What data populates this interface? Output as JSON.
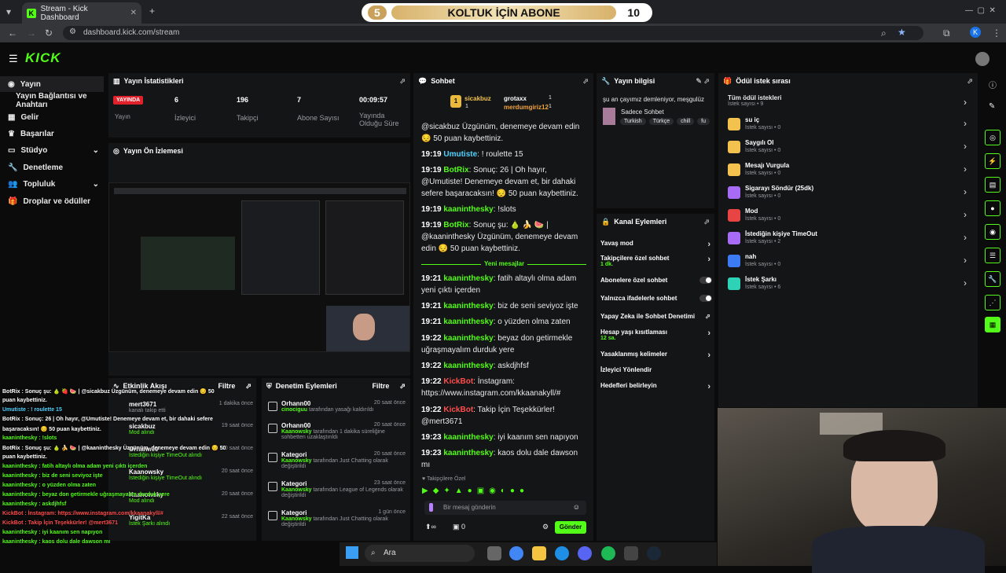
{
  "browser": {
    "tab_title": "Stream - Kick Dashboard",
    "url": "dashboard.kick.com/stream",
    "new_tab": "+",
    "profile_initial": "K"
  },
  "goal_banner": {
    "left": "5",
    "title": "KOLTUK İÇİN ABONE",
    "right": "10"
  },
  "kick": {
    "logo": "KICK"
  },
  "sidebar": {
    "items": [
      {
        "label": "Yayın",
        "icon": "broadcast-icon"
      },
      {
        "label": "Yayın Bağlantısı ve Anahtarı",
        "icon": ""
      },
      {
        "label": "Gelir",
        "icon": "revenue-icon"
      },
      {
        "label": "Başarılar",
        "icon": "trophy-icon"
      },
      {
        "label": "Stüdyo",
        "icon": "studio-icon"
      },
      {
        "label": "Denetleme",
        "icon": "wrench-icon"
      },
      {
        "label": "Topluluk",
        "icon": "people-icon"
      },
      {
        "label": "Droplar ve ödüller",
        "icon": "gift-icon"
      }
    ]
  },
  "stats": {
    "title": "Yayın İstatistikleri",
    "live_badge": "YAYINDA",
    "live_label": "Yayın",
    "items": [
      {
        "value": "6",
        "label": "İzleyici"
      },
      {
        "value": "196",
        "label": "Takipçi"
      },
      {
        "value": "7",
        "label": "Abone Sayısı"
      },
      {
        "value": "00:09:57",
        "label": "Yayında Olduğu Süre"
      }
    ]
  },
  "preview": {
    "title": "Yayın Ön İzlemesi"
  },
  "activity": {
    "title": "Etkinlik Akışı",
    "filter": "Filtre",
    "rows": [
      {
        "name": "mert3671",
        "sub": "kanalı takip etti",
        "date": "1 dakika önce"
      },
      {
        "name": "sicakbuz",
        "sub": "Mod alındı",
        "date": "19 saat önce"
      },
      {
        "name": "Orhann00",
        "sub": "İstediğin kişiye TimeOut alındı",
        "date": "20 saat önce"
      },
      {
        "name": "Kaanowsky",
        "sub": "İstediğin kişiye TimeOut alındı",
        "date": "20 saat önce"
      },
      {
        "name": "Kaanowsky",
        "sub": "Mod alındı",
        "date": "20 saat önce"
      },
      {
        "name": "YigitKa",
        "sub": "İstek Şarkı alındı",
        "date": "22 saat önce"
      }
    ]
  },
  "moderation": {
    "title": "Denetim Eylemleri",
    "filter": "Filtre",
    "rows": [
      {
        "name": "Orhann00",
        "actor": "cinociguu",
        "text": "tarafından yasağı kaldırıldı",
        "date": "20 saat önce"
      },
      {
        "name": "Orhann00",
        "actor": "Kaanowsky",
        "text": "tarafından 1 dakika süreliğine sohbetten uzaklaştırıldı",
        "date": "20 saat önce"
      },
      {
        "name": "Kategori",
        "actor": "Kaanowsky",
        "text": "tarafından Just Chatting olarak değiştirildi",
        "date": "20 saat önce"
      },
      {
        "name": "Kategori",
        "actor": "Kaanowsky",
        "text": "tarafından League of Legends olarak değiştirildi",
        "date": "23 saat önce"
      },
      {
        "name": "Kategori",
        "actor": "Kaanowsky",
        "text": "tarafından Just Chatting olarak değiştirildi",
        "date": "1 gün önce"
      }
    ]
  },
  "chat": {
    "title": "Sohbet",
    "leaders": [
      {
        "name": "sicakbuz",
        "count": "1"
      },
      {
        "name": "grotaxx",
        "count": "1"
      },
      {
        "name": "merdumgiriz12",
        "count": "1"
      }
    ],
    "lines": [
      {
        "time": "",
        "user": "",
        "text": "@sicakbuz Üzgünüm, denemeye devam edin 😔 50 puan kaybettiniz."
      },
      {
        "time": "19:19",
        "user": "Umutiste",
        "text": ": ! roulette 15"
      },
      {
        "time": "19:19",
        "user": "BotRix",
        "text": ": Sonuç: 26 | Oh hayır, @Umutiste! Denemeye devam et, bir dahaki sefere başaracaksın! 😔 50 puan kaybettiniz."
      },
      {
        "time": "19:19",
        "user": "kaaninthesky",
        "text": ": !slots"
      },
      {
        "time": "19:19",
        "user": "BotRix",
        "text": ": Sonuç şu: 🍐 🍌 🍉 | @kaaninthesky Üzgünüm, denemeye devam edin 😔 50 puan kaybettiniz."
      },
      {
        "time": "19:21",
        "user": "kaaninthesky",
        "text": ": fatih altaylı olma adam yeni çıktı içerden"
      },
      {
        "time": "19:21",
        "user": "kaaninthesky",
        "text": ": biz de seni seviyoz işte"
      },
      {
        "time": "19:21",
        "user": "kaaninthesky",
        "text": ": o yüzden olma zaten"
      },
      {
        "time": "19:22",
        "user": "kaaninthesky",
        "text": ": beyaz don getirmekle uğraşmayalım durduk yere"
      },
      {
        "time": "19:22",
        "user": "kaaninthesky",
        "text": ": askdjhfsf"
      },
      {
        "time": "19:22",
        "user": "KickBot",
        "text": ": İnstagram: https://www.instagram.com/kkaanakyll/#"
      },
      {
        "time": "19:22",
        "user": "KickBot",
        "text": ": Takip İçin Teşekkürler! @mert3671"
      },
      {
        "time": "19:23",
        "user": "kaaninthesky",
        "text": ": iyi kaanım sen napıyon"
      },
      {
        "time": "19:23",
        "user": "kaaninthesky",
        "text": ": kaos dolu dale dawson mı"
      }
    ],
    "new_messages": "Yeni mesajlar",
    "followers_only": "Takipçilere Özel",
    "placeholder": "Bir mesaj gönderin",
    "count_a": "0",
    "send": "Gönder"
  },
  "stream_info": {
    "title": "Yayın bilgisi",
    "stream_title": "şu an çayımız demleniyor, meşgulüz",
    "category": "Sadece Sohbet",
    "tags": [
      "Turkish",
      "Türkçe",
      "chill",
      "fu"
    ]
  },
  "channel_actions": {
    "title": "Kanal Eylemleri",
    "items": [
      {
        "label": "Yavaş mod",
        "sub": "",
        "kind": "chev"
      },
      {
        "label": "Takipçilere özel sohbet",
        "sub": "1 dk.",
        "kind": "chev"
      },
      {
        "label": "Abonelere özel sohbet",
        "sub": "",
        "kind": "toggle"
      },
      {
        "label": "Yalnızca ifadelerle sohbet",
        "sub": "",
        "kind": "toggle"
      },
      {
        "label": "Yapay Zeka ile Sohbet Denetimi",
        "sub": "",
        "kind": "ext"
      },
      {
        "label": "Hesap yaşı kısıtlaması",
        "sub": "12 sa.",
        "kind": "chev"
      },
      {
        "label": "Yasaklanmış kelimeler",
        "sub": "",
        "kind": "chev"
      },
      {
        "label": "İzleyici Yönlendir",
        "sub": "",
        "kind": ""
      },
      {
        "label": "Hedefleri belirleyin",
        "sub": "",
        "kind": "chev"
      }
    ]
  },
  "rewards": {
    "title": "Ödül istek sırası",
    "all": "Tüm ödül istekleri",
    "all_sub": "İstek sayısı • 9",
    "items": [
      {
        "name": "su iç",
        "sub": "İstek sayısı • 0",
        "color": "#f2c14e"
      },
      {
        "name": "Saygılı Ol",
        "sub": "İstek sayısı • 0",
        "color": "#f2c14e"
      },
      {
        "name": "Mesajı Vurgula",
        "sub": "İstek sayısı • 0",
        "color": "#f2c14e"
      },
      {
        "name": "Sigarayı Söndür (25dk)",
        "sub": "İstek sayısı • 0",
        "color": "#a86bf5"
      },
      {
        "name": "Mod",
        "sub": "İstek sayısı • 0",
        "color": "#e94444"
      },
      {
        "name": "İstediğin kişiye TimeOut",
        "sub": "İstek sayısı • 2",
        "color": "#a86bf5"
      },
      {
        "name": "nah",
        "sub": "İstek sayısı • 0",
        "color": "#3b7cf5"
      },
      {
        "name": "İstek Şarkı",
        "sub": "İstek sayısı • 6",
        "color": "#2ed3b7"
      }
    ]
  },
  "overlay_chat": [
    "BotRix : Sonuç şu: 🍐 🍓 🍉 | @sicakbuz Üzgünüm, denemeye devam edin 😔 50",
    "puan kaybettiniz.",
    "Umutiste : ! roulette 15",
    "BotRix : Sonuç: 26 | Oh hayır, @Umutiste! Denemeye devam et, bir dahaki sefere",
    "başaracaksın! 😔 50 puan kaybettiniz.",
    "kaaninthesky : !slots",
    "BotRix : Sonuç şu: 🍐 🍌 🍉 | @kaaninthesky Üzgünüm, denemeye devam edin 😔 50",
    "puan kaybettiniz.",
    "kaaninthesky : fatih altaylı olma adam yeni çıktı içerden",
    "kaaninthesky : biz de seni seviyoz işte",
    "kaaninthesky : o yüzden olma zaten",
    "kaaninthesky : beyaz don getirmekle uğraşmayalım durduk yere",
    "kaaninthesky : askdjhfsf",
    "KickBot : İnstagram: https://www.instagram.com/kkaanakyll/#",
    "KickBot : Takip İçin Teşekkürler! @mert3671",
    "kaaninthesky : iyi kaanım sen napıyon",
    "kaaninthesky : kaos dolu dale dawson mı"
  ],
  "taskbar": {
    "search": "Ara"
  },
  "colors": {
    "accent": "#53fc18",
    "panel": "#141517",
    "bot_red": "#ff4d4d"
  }
}
